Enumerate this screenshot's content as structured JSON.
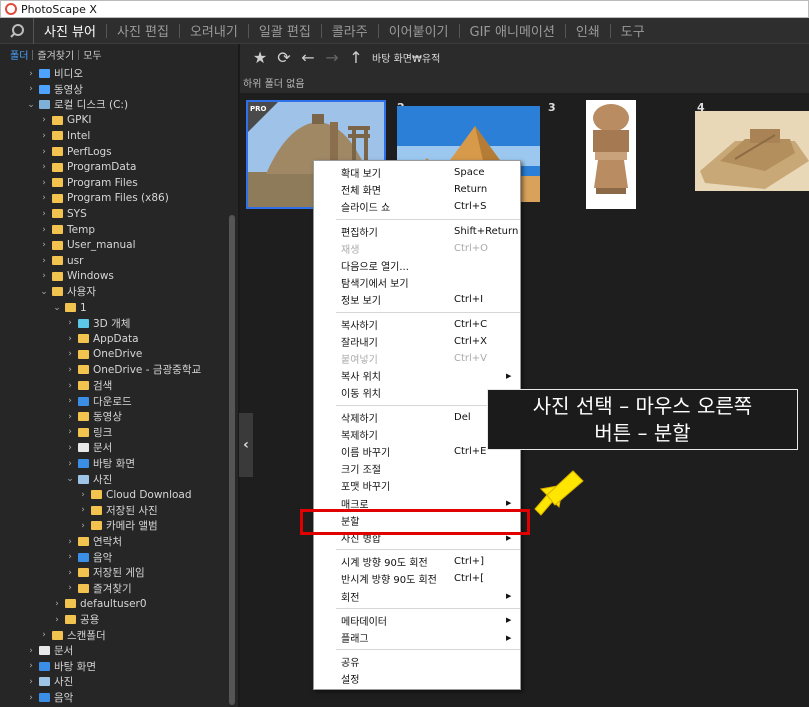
{
  "window": {
    "title": "PhotoScape X"
  },
  "menu": [
    "사진 뷰어",
    "사진 편집",
    "오려내기",
    "일괄 편집",
    "콜라주",
    "이어붙이기",
    "GIF 애니메이션",
    "인쇄",
    "도구"
  ],
  "menu_active": 0,
  "sidebar_tabs": [
    "폴더",
    "즐겨찾기",
    "모두"
  ],
  "tree": [
    {
      "label": "비디오",
      "indent": 0,
      "arrow": "›",
      "color": "#4da3ff"
    },
    {
      "label": "동영상",
      "indent": 0,
      "arrow": "›",
      "color": "#4da3ff"
    },
    {
      "label": "로컬 디스크 (C:)",
      "indent": 0,
      "arrow": "⌄",
      "color": "#7fb0d8"
    },
    {
      "label": "GPKI",
      "indent": 1,
      "arrow": "›",
      "color": "#f3c34f"
    },
    {
      "label": "Intel",
      "indent": 1,
      "arrow": "›",
      "color": "#f3c34f"
    },
    {
      "label": "PerfLogs",
      "indent": 1,
      "arrow": "›",
      "color": "#f3c34f"
    },
    {
      "label": "ProgramData",
      "indent": 1,
      "arrow": "›",
      "color": "#f3c34f"
    },
    {
      "label": "Program Files",
      "indent": 1,
      "arrow": "›",
      "color": "#f3c34f"
    },
    {
      "label": "Program Files (x86)",
      "indent": 1,
      "arrow": "›",
      "color": "#f3c34f"
    },
    {
      "label": "SYS",
      "indent": 1,
      "arrow": "›",
      "color": "#f3c34f"
    },
    {
      "label": "Temp",
      "indent": 1,
      "arrow": "›",
      "color": "#f3c34f"
    },
    {
      "label": "User_manual",
      "indent": 1,
      "arrow": "›",
      "color": "#f3c34f"
    },
    {
      "label": "usr",
      "indent": 1,
      "arrow": "›",
      "color": "#f3c34f"
    },
    {
      "label": "Windows",
      "indent": 1,
      "arrow": "›",
      "color": "#f3c34f"
    },
    {
      "label": "사용자",
      "indent": 1,
      "arrow": "⌄",
      "color": "#f3c34f"
    },
    {
      "label": "1",
      "indent": 2,
      "arrow": "⌄",
      "color": "#f3c34f"
    },
    {
      "label": "3D 개체",
      "indent": 3,
      "arrow": "›",
      "color": "#5cc8e8"
    },
    {
      "label": "AppData",
      "indent": 3,
      "arrow": "›",
      "color": "#f3c34f"
    },
    {
      "label": "OneDrive",
      "indent": 3,
      "arrow": "›",
      "color": "#f3c34f"
    },
    {
      "label": "OneDrive - 금광중학교",
      "indent": 3,
      "arrow": "›",
      "color": "#f3c34f"
    },
    {
      "label": "검색",
      "indent": 3,
      "arrow": "›",
      "color": "#f3c34f"
    },
    {
      "label": "다운로드",
      "indent": 3,
      "arrow": "›",
      "color": "#3a8ee6"
    },
    {
      "label": "동영상",
      "indent": 3,
      "arrow": "›",
      "color": "#f3c34f"
    },
    {
      "label": "링크",
      "indent": 3,
      "arrow": "›",
      "color": "#f3c34f"
    },
    {
      "label": "문서",
      "indent": 3,
      "arrow": "›",
      "color": "#e8e8e8"
    },
    {
      "label": "바탕 화면",
      "indent": 3,
      "arrow": "›",
      "color": "#3a8ee6"
    },
    {
      "label": "사진",
      "indent": 3,
      "arrow": "⌄",
      "color": "#9ec4e8"
    },
    {
      "label": "Cloud Download",
      "indent": 4,
      "arrow": "›",
      "color": "#f3c34f"
    },
    {
      "label": "저장된 사진",
      "indent": 4,
      "arrow": "›",
      "color": "#f3c34f"
    },
    {
      "label": "카메라 앨범",
      "indent": 4,
      "arrow": "›",
      "color": "#f3c34f"
    },
    {
      "label": "연락처",
      "indent": 3,
      "arrow": "›",
      "color": "#f3c34f"
    },
    {
      "label": "음악",
      "indent": 3,
      "arrow": "›",
      "color": "#3a8ee6"
    },
    {
      "label": "저장된 게임",
      "indent": 3,
      "arrow": "›",
      "color": "#f3c34f"
    },
    {
      "label": "즐겨찾기",
      "indent": 3,
      "arrow": "›",
      "color": "#f3c34f"
    },
    {
      "label": "defaultuser0",
      "indent": 2,
      "arrow": "›",
      "color": "#f3c34f"
    },
    {
      "label": "공용",
      "indent": 2,
      "arrow": "›",
      "color": "#f3c34f"
    },
    {
      "label": "스캔폴더",
      "indent": 1,
      "arrow": "›",
      "color": "#f3c34f"
    },
    {
      "label": "문서",
      "indent": 0,
      "arrow": "›",
      "color": "#e8e8e8"
    },
    {
      "label": "바탕 화면",
      "indent": 0,
      "arrow": "›",
      "color": "#3a8ee6"
    },
    {
      "label": "사진",
      "indent": 0,
      "arrow": "›",
      "color": "#9ec4e8"
    },
    {
      "label": "음악",
      "indent": 0,
      "arrow": "›",
      "color": "#3a8ee6"
    }
  ],
  "toolbar": {
    "path": "바탕 화면₩유적"
  },
  "crumb": "하위 폴더 없음",
  "thumbs": [
    {
      "num": "",
      "badge": "PRO"
    },
    {
      "num": "2"
    },
    {
      "num": "3"
    },
    {
      "num": "4"
    }
  ],
  "context_menu": [
    {
      "label": "확대 보기",
      "key": "Space"
    },
    {
      "label": "전체 화면",
      "key": "Return"
    },
    {
      "label": "슬라이드 쇼",
      "key": "Ctrl+S"
    },
    {
      "sep": true
    },
    {
      "label": "편집하기",
      "key": "Shift+Return"
    },
    {
      "label": "재생",
      "key": "Ctrl+O",
      "disabled": true
    },
    {
      "label": "다음으로 열기...",
      "key": ""
    },
    {
      "label": "탐색기에서 보기",
      "key": ""
    },
    {
      "label": "정보 보기",
      "key": "Ctrl+I"
    },
    {
      "sep": true
    },
    {
      "label": "복사하기",
      "key": "Ctrl+C"
    },
    {
      "label": "잘라내기",
      "key": "Ctrl+X"
    },
    {
      "label": "붙여넣기",
      "key": "Ctrl+V",
      "disabled": true
    },
    {
      "label": "복사 위치",
      "key": "",
      "sub": true
    },
    {
      "label": "이동 위치",
      "key": "",
      "sub": true
    },
    {
      "sep": true
    },
    {
      "label": "삭제하기",
      "key": "Del"
    },
    {
      "label": "복제하기",
      "key": ""
    },
    {
      "label": "이름 바꾸기",
      "key": "Ctrl+E"
    },
    {
      "label": "크기 조절",
      "key": ""
    },
    {
      "label": "포맷 바꾸기",
      "key": ""
    },
    {
      "label": "매크로",
      "key": "",
      "sub": true
    },
    {
      "label": "분할",
      "key": ""
    },
    {
      "label": "사진 병합",
      "key": "",
      "sub": true
    },
    {
      "sep": true
    },
    {
      "label": "시계 방향 90도 회전",
      "key": "Ctrl+]"
    },
    {
      "label": "반시계 방향 90도 회전",
      "key": "Ctrl+["
    },
    {
      "label": "회전",
      "key": "",
      "sub": true
    },
    {
      "sep": true
    },
    {
      "label": "메타데이터",
      "key": "",
      "sub": true
    },
    {
      "label": "플래그",
      "key": "",
      "sub": true
    },
    {
      "sep": true
    },
    {
      "label": "공유",
      "key": ""
    },
    {
      "label": "설정",
      "key": ""
    }
  ],
  "callout": {
    "line1": "사진 선택 – 마우스 오른쪽",
    "line2": "버튼 – 분할"
  },
  "colors": {
    "accent": "#4aa3ff",
    "highlight": "#e00000",
    "arrow": "#ffe000"
  }
}
